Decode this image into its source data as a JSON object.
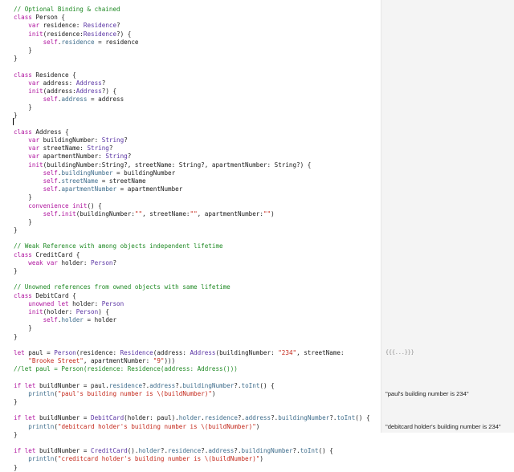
{
  "editor": {
    "lines": [
      [
        {
          "t": "// Optional Binding & chained",
          "c": "cm"
        }
      ],
      [
        {
          "t": "class",
          "c": "kw"
        },
        {
          "t": " Person {"
        }
      ],
      [
        {
          "t": "    "
        },
        {
          "t": "var",
          "c": "kw"
        },
        {
          "t": " residence: "
        },
        {
          "t": "Residence",
          "c": "ty"
        },
        {
          "t": "?"
        }
      ],
      [
        {
          "t": "    "
        },
        {
          "t": "init",
          "c": "kw"
        },
        {
          "t": "(residence:"
        },
        {
          "t": "Residence",
          "c": "ty"
        },
        {
          "t": "?) {"
        }
      ],
      [
        {
          "t": "        "
        },
        {
          "t": "self",
          "c": "kw"
        },
        {
          "t": "."
        },
        {
          "t": "residence",
          "c": "pr"
        },
        {
          "t": " = residence"
        }
      ],
      [
        {
          "t": "    }"
        }
      ],
      [
        {
          "t": "}"
        }
      ],
      [],
      [
        {
          "t": "class",
          "c": "kw"
        },
        {
          "t": " Residence {"
        }
      ],
      [
        {
          "t": "    "
        },
        {
          "t": "var",
          "c": "kw"
        },
        {
          "t": " address: "
        },
        {
          "t": "Address",
          "c": "ty"
        },
        {
          "t": "?"
        }
      ],
      [
        {
          "t": "    "
        },
        {
          "t": "init",
          "c": "kw"
        },
        {
          "t": "(address:"
        },
        {
          "t": "Address",
          "c": "ty"
        },
        {
          "t": "?) {"
        }
      ],
      [
        {
          "t": "        "
        },
        {
          "t": "self",
          "c": "kw"
        },
        {
          "t": "."
        },
        {
          "t": "address",
          "c": "pr"
        },
        {
          "t": " = address"
        }
      ],
      [
        {
          "t": "    }"
        }
      ],
      [
        {
          "t": "}"
        }
      ],
      [],
      [
        {
          "t": "class",
          "c": "kw"
        },
        {
          "t": " Address {"
        }
      ],
      [
        {
          "t": "    "
        },
        {
          "t": "var",
          "c": "kw"
        },
        {
          "t": " buildingNumber: "
        },
        {
          "t": "String",
          "c": "ty"
        },
        {
          "t": "?"
        }
      ],
      [
        {
          "t": "    "
        },
        {
          "t": "var",
          "c": "kw"
        },
        {
          "t": " streetName: "
        },
        {
          "t": "String",
          "c": "ty"
        },
        {
          "t": "?"
        }
      ],
      [
        {
          "t": "    "
        },
        {
          "t": "var",
          "c": "kw"
        },
        {
          "t": " apartmentNumber: "
        },
        {
          "t": "String",
          "c": "ty"
        },
        {
          "t": "?"
        }
      ],
      [
        {
          "t": "    "
        },
        {
          "t": "init",
          "c": "kw"
        },
        {
          "t": "(buildingNumber:String?, streetName: String?, apartmentNumber: String?) {"
        }
      ],
      [
        {
          "t": "        "
        },
        {
          "t": "self",
          "c": "kw"
        },
        {
          "t": "."
        },
        {
          "t": "buildingNumber",
          "c": "pr"
        },
        {
          "t": " = buildingNumber"
        }
      ],
      [
        {
          "t": "        "
        },
        {
          "t": "self",
          "c": "kw"
        },
        {
          "t": "."
        },
        {
          "t": "streetName",
          "c": "pr"
        },
        {
          "t": " = streetName"
        }
      ],
      [
        {
          "t": "        "
        },
        {
          "t": "self",
          "c": "kw"
        },
        {
          "t": "."
        },
        {
          "t": "apartmentNumber",
          "c": "pr"
        },
        {
          "t": " = apartmentNumber"
        }
      ],
      [
        {
          "t": "    }"
        }
      ],
      [
        {
          "t": "    "
        },
        {
          "t": "convenience init",
          "c": "kw"
        },
        {
          "t": "() {"
        }
      ],
      [
        {
          "t": "        "
        },
        {
          "t": "self",
          "c": "kw"
        },
        {
          "t": "."
        },
        {
          "t": "init",
          "c": "kw"
        },
        {
          "t": "(buildingNumber:"
        },
        {
          "t": "\"\"",
          "c": "st"
        },
        {
          "t": ", streetName:"
        },
        {
          "t": "\"\"",
          "c": "st"
        },
        {
          "t": ", apartmentNumber:"
        },
        {
          "t": "\"\"",
          "c": "st"
        },
        {
          "t": ")"
        }
      ],
      [
        {
          "t": "    }"
        }
      ],
      [
        {
          "t": "}"
        }
      ],
      [],
      [
        {
          "t": "// Weak Reference with among objects independent lifetime",
          "c": "cm"
        }
      ],
      [
        {
          "t": "class",
          "c": "kw"
        },
        {
          "t": " CreditCard {"
        }
      ],
      [
        {
          "t": "    "
        },
        {
          "t": "weak var",
          "c": "kw"
        },
        {
          "t": " holder: "
        },
        {
          "t": "Person",
          "c": "ty"
        },
        {
          "t": "?"
        }
      ],
      [
        {
          "t": "}"
        }
      ],
      [],
      [
        {
          "t": "// Unowned references from owned objects with same lifetime",
          "c": "cm"
        }
      ],
      [
        {
          "t": "class",
          "c": "kw"
        },
        {
          "t": " DebitCard {"
        }
      ],
      [
        {
          "t": "    "
        },
        {
          "t": "unowned let",
          "c": "kw"
        },
        {
          "t": " holder: "
        },
        {
          "t": "Person",
          "c": "ty"
        }
      ],
      [
        {
          "t": "    "
        },
        {
          "t": "init",
          "c": "kw"
        },
        {
          "t": "(holder: "
        },
        {
          "t": "Person",
          "c": "ty"
        },
        {
          "t": ") {"
        }
      ],
      [
        {
          "t": "        "
        },
        {
          "t": "self",
          "c": "kw"
        },
        {
          "t": "."
        },
        {
          "t": "holder",
          "c": "pr"
        },
        {
          "t": " = holder"
        }
      ],
      [
        {
          "t": "    }"
        }
      ],
      [
        {
          "t": "}"
        }
      ],
      [],
      [
        {
          "t": "let",
          "c": "kw"
        },
        {
          "t": " paul = "
        },
        {
          "t": "Person",
          "c": "ty"
        },
        {
          "t": "(residence: "
        },
        {
          "t": "Residence",
          "c": "ty"
        },
        {
          "t": "(address: "
        },
        {
          "t": "Address",
          "c": "ty"
        },
        {
          "t": "(buildingNumber: "
        },
        {
          "t": "\"234\"",
          "c": "st"
        },
        {
          "t": ", streetName:"
        }
      ],
      [
        {
          "t": "    "
        },
        {
          "t": "\"Brooke Street\"",
          "c": "st"
        },
        {
          "t": ", apartmentNumber: "
        },
        {
          "t": "\"9\"",
          "c": "st"
        },
        {
          "t": ")))"
        }
      ],
      [
        {
          "t": "//let paul = Person(residence: Residence(address: Address()))",
          "c": "cm"
        }
      ],
      [],
      [
        {
          "t": "if let",
          "c": "kw"
        },
        {
          "t": " buildNumber = paul."
        },
        {
          "t": "residence",
          "c": "pr"
        },
        {
          "t": "?."
        },
        {
          "t": "address",
          "c": "pr"
        },
        {
          "t": "?."
        },
        {
          "t": "buildingNumber",
          "c": "pr"
        },
        {
          "t": "?."
        },
        {
          "t": "toInt",
          "c": "pr"
        },
        {
          "t": "() {"
        }
      ],
      [
        {
          "t": "    "
        },
        {
          "t": "println",
          "c": "pr"
        },
        {
          "t": "("
        },
        {
          "t": "\"paul's building number is \\(buildNumber)\"",
          "c": "st"
        },
        {
          "t": ")"
        }
      ],
      [
        {
          "t": "}"
        }
      ],
      [],
      [
        {
          "t": "if let",
          "c": "kw"
        },
        {
          "t": " buildNumber = "
        },
        {
          "t": "DebitCard",
          "c": "ty"
        },
        {
          "t": "(holder: paul)."
        },
        {
          "t": "holder",
          "c": "pr"
        },
        {
          "t": "."
        },
        {
          "t": "residence",
          "c": "pr"
        },
        {
          "t": "?."
        },
        {
          "t": "address",
          "c": "pr"
        },
        {
          "t": "?."
        },
        {
          "t": "buildingNumber",
          "c": "pr"
        },
        {
          "t": "?."
        },
        {
          "t": "toInt",
          "c": "pr"
        },
        {
          "t": "() {"
        }
      ],
      [
        {
          "t": "    "
        },
        {
          "t": "println",
          "c": "pr"
        },
        {
          "t": "("
        },
        {
          "t": "\"debitcard holder's building number is \\(buildNumber)\"",
          "c": "st"
        },
        {
          "t": ")"
        }
      ],
      [
        {
          "t": "}"
        }
      ],
      [],
      [
        {
          "t": "if let",
          "c": "kw"
        },
        {
          "t": " buildNumber = "
        },
        {
          "t": "CreditCard",
          "c": "ty"
        },
        {
          "t": "()."
        },
        {
          "t": "holder",
          "c": "pr"
        },
        {
          "t": "?."
        },
        {
          "t": "residence",
          "c": "pr"
        },
        {
          "t": "?."
        },
        {
          "t": "address",
          "c": "pr"
        },
        {
          "t": "?."
        },
        {
          "t": "buildingNumber",
          "c": "pr"
        },
        {
          "t": "?."
        },
        {
          "t": "toInt",
          "c": "pr"
        },
        {
          "t": "() {"
        }
      ],
      [
        {
          "t": "    "
        },
        {
          "t": "println",
          "c": "pr"
        },
        {
          "t": "("
        },
        {
          "t": "\"creditcard holder's building number is \\(buildNumber)\"",
          "c": "st"
        },
        {
          "t": ")"
        }
      ],
      [
        {
          "t": "}"
        }
      ]
    ]
  },
  "results_sidebar": {
    "results": [
      {
        "text": "{{{...}}}",
        "style": "dim",
        "line": 42
      },
      {
        "text": "\"paul's building number is 234\"",
        "style": "normal",
        "line": 47
      },
      {
        "text": "\"debitcard holder's building number is 234\"",
        "style": "normal",
        "line": 51
      }
    ]
  },
  "colors": {
    "keyword": "#b0169f",
    "type": "#5a34a4",
    "string": "#c4281b",
    "comment": "#1f8a24",
    "property": "#3e6d8c",
    "sidebar_bg": "#f4f4f4"
  }
}
